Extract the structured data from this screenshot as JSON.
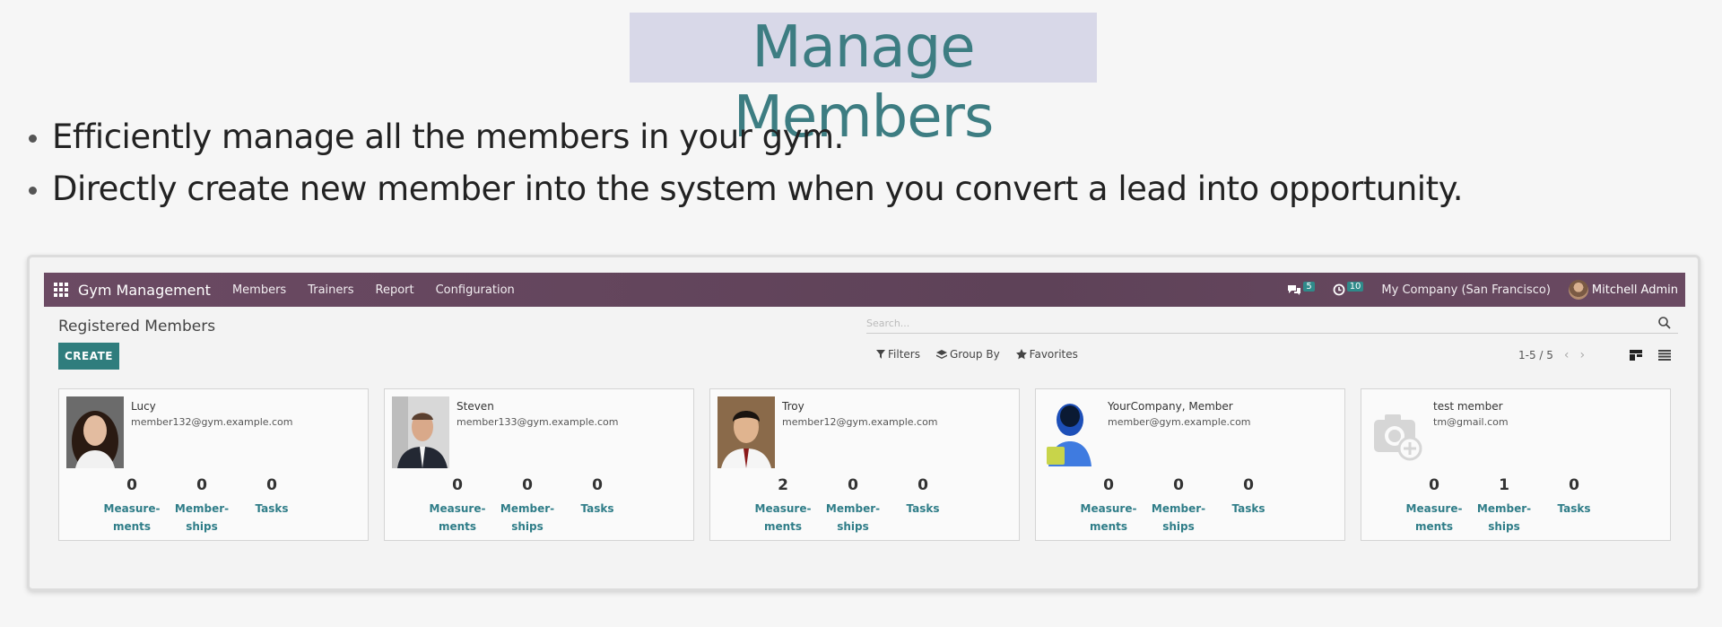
{
  "slide": {
    "title": "Manage Members",
    "bullets": [
      "Efficiently manage all the members in your gym.",
      "Directly create new member into the system when you convert a lead into opportunity."
    ]
  },
  "navbar": {
    "app_name": "Gym Management",
    "menu": [
      "Members",
      "Trainers",
      "Report",
      "Configuration"
    ],
    "messages_count": "5",
    "activities_count": "10",
    "company": "My Company (San Francisco)",
    "user": "Mitchell Admin",
    "color": "#654960"
  },
  "control_panel": {
    "title": "Registered Members",
    "create_label": "CREATE",
    "search_placeholder": "Search...",
    "filters": [
      "Filters",
      "Group By",
      "Favorites"
    ],
    "pager": "1-5 / 5"
  },
  "stat_labels": [
    "Measure-\nments",
    "Member-\nships",
    "Tasks"
  ],
  "members": [
    {
      "name": "Lucy",
      "email": "member132@gym.example.com",
      "photo": "woman-photo",
      "measurements": "0",
      "memberships": "0",
      "tasks": "0"
    },
    {
      "name": "Steven",
      "email": "member133@gym.example.com",
      "photo": "man-suit-photo",
      "measurements": "0",
      "memberships": "0",
      "tasks": "0"
    },
    {
      "name": "Troy",
      "email": "member12@gym.example.com",
      "photo": "young-man-photo",
      "measurements": "2",
      "memberships": "0",
      "tasks": "0"
    },
    {
      "name": "YourCompany, Member",
      "email": "member@gym.example.com",
      "photo": "default-user-avatar",
      "measurements": "0",
      "memberships": "0",
      "tasks": "0"
    },
    {
      "name": "test member",
      "email": "tm@gmail.com",
      "photo": "camera-placeholder",
      "measurements": "0",
      "memberships": "1",
      "tasks": "0"
    }
  ],
  "colors": {
    "accent": "#2f7d7d",
    "title": "#3d7d82",
    "title_highlight": "#d8d8e8"
  }
}
